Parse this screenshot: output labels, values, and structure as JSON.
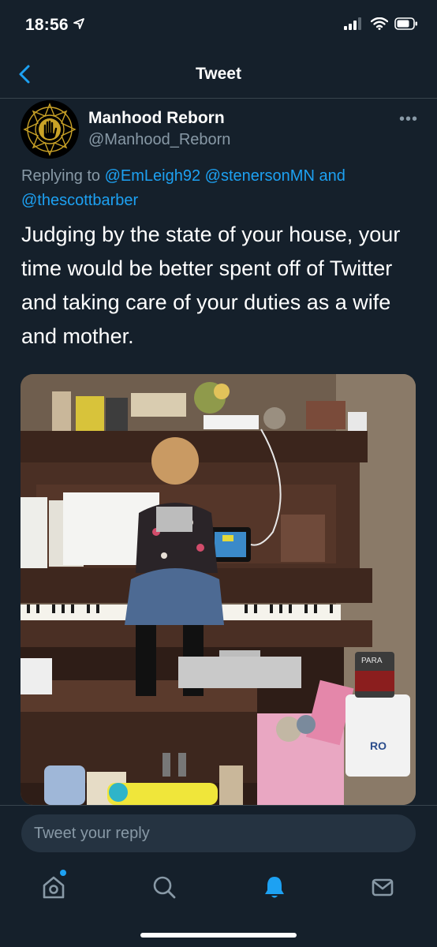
{
  "status_bar": {
    "time": "18:56",
    "icons": [
      "location-arrow-icon",
      "signal-icon",
      "wifi-icon",
      "battery-icon"
    ]
  },
  "nav": {
    "back_icon": "chevron-left-icon",
    "title": "Tweet"
  },
  "tweet": {
    "author_name": "Manhood Reborn",
    "author_handle": "@Manhood_Reborn",
    "more_label": "•••",
    "replying_to_prefix": "Replying to",
    "mention_1": "@EmLeigh92",
    "mention_2": "@stenersonMN",
    "and_word": "and",
    "mention_3": "@thescottbarber",
    "text": "Judging by the state of your house, your time would be better spent off of Twitter and taking care of your duties as a wife and mother.",
    "photo_signs": {
      "para": "PARA",
      "ro": "RO"
    }
  },
  "reply_box": {
    "placeholder": "Tweet your reply"
  },
  "tab_bar": {
    "items": [
      "home-icon",
      "search-icon",
      "notifications-bell-icon",
      "messages-envelope-icon"
    ],
    "active": "notifications-bell-icon"
  },
  "colors": {
    "background": "#15202b",
    "accent": "#1da1f2",
    "secondary_text": "#8899a6",
    "divider": "#38444d"
  }
}
